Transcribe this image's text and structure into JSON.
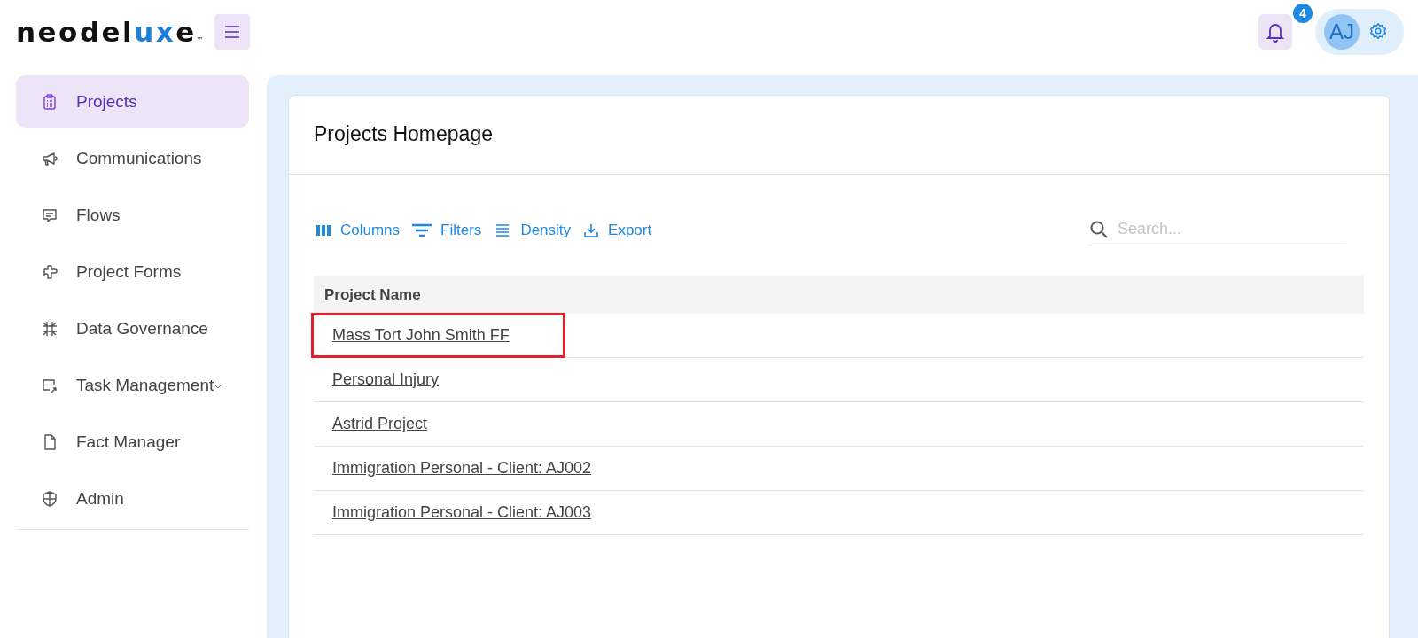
{
  "header": {
    "logo": {
      "parts": [
        {
          "text": "neodel",
          "accent": false
        },
        {
          "text": "ux",
          "accent": true
        },
        {
          "text": "e",
          "accent": false
        }
      ],
      "mark": "™"
    },
    "notifications": {
      "count": "4"
    },
    "user": {
      "initials": "AJ"
    }
  },
  "sidebar": {
    "items": [
      {
        "label": "Projects",
        "selected": true,
        "expandable": false
      },
      {
        "label": "Communications",
        "selected": false,
        "expandable": false
      },
      {
        "label": "Flows",
        "selected": false,
        "expandable": false
      },
      {
        "label": "Project Forms",
        "selected": false,
        "expandable": false
      },
      {
        "label": "Data Governance",
        "selected": false,
        "expandable": false
      },
      {
        "label": "Task Management",
        "selected": false,
        "expandable": true
      },
      {
        "label": "Fact Manager",
        "selected": false,
        "expandable": false
      },
      {
        "label": "Admin",
        "selected": false,
        "expandable": false
      }
    ]
  },
  "card": {
    "title": "Projects Homepage",
    "toolbar": [
      {
        "label": "Columns"
      },
      {
        "label": "Filters"
      },
      {
        "label": "Density"
      },
      {
        "label": "Export"
      }
    ],
    "search": {
      "placeholder": "Search..."
    },
    "table": {
      "columns": [
        "Project Name"
      ],
      "rows": [
        {
          "name": "Mass Tort John Smith FF",
          "highlighted": true
        },
        {
          "name": "Personal Injury",
          "highlighted": false
        },
        {
          "name": "Astrid Project",
          "highlighted": false
        },
        {
          "name": "Immigration Personal - Client: AJ002",
          "highlighted": false
        },
        {
          "name": "Immigration Personal - Client: AJ003",
          "highlighted": false
        }
      ]
    }
  }
}
